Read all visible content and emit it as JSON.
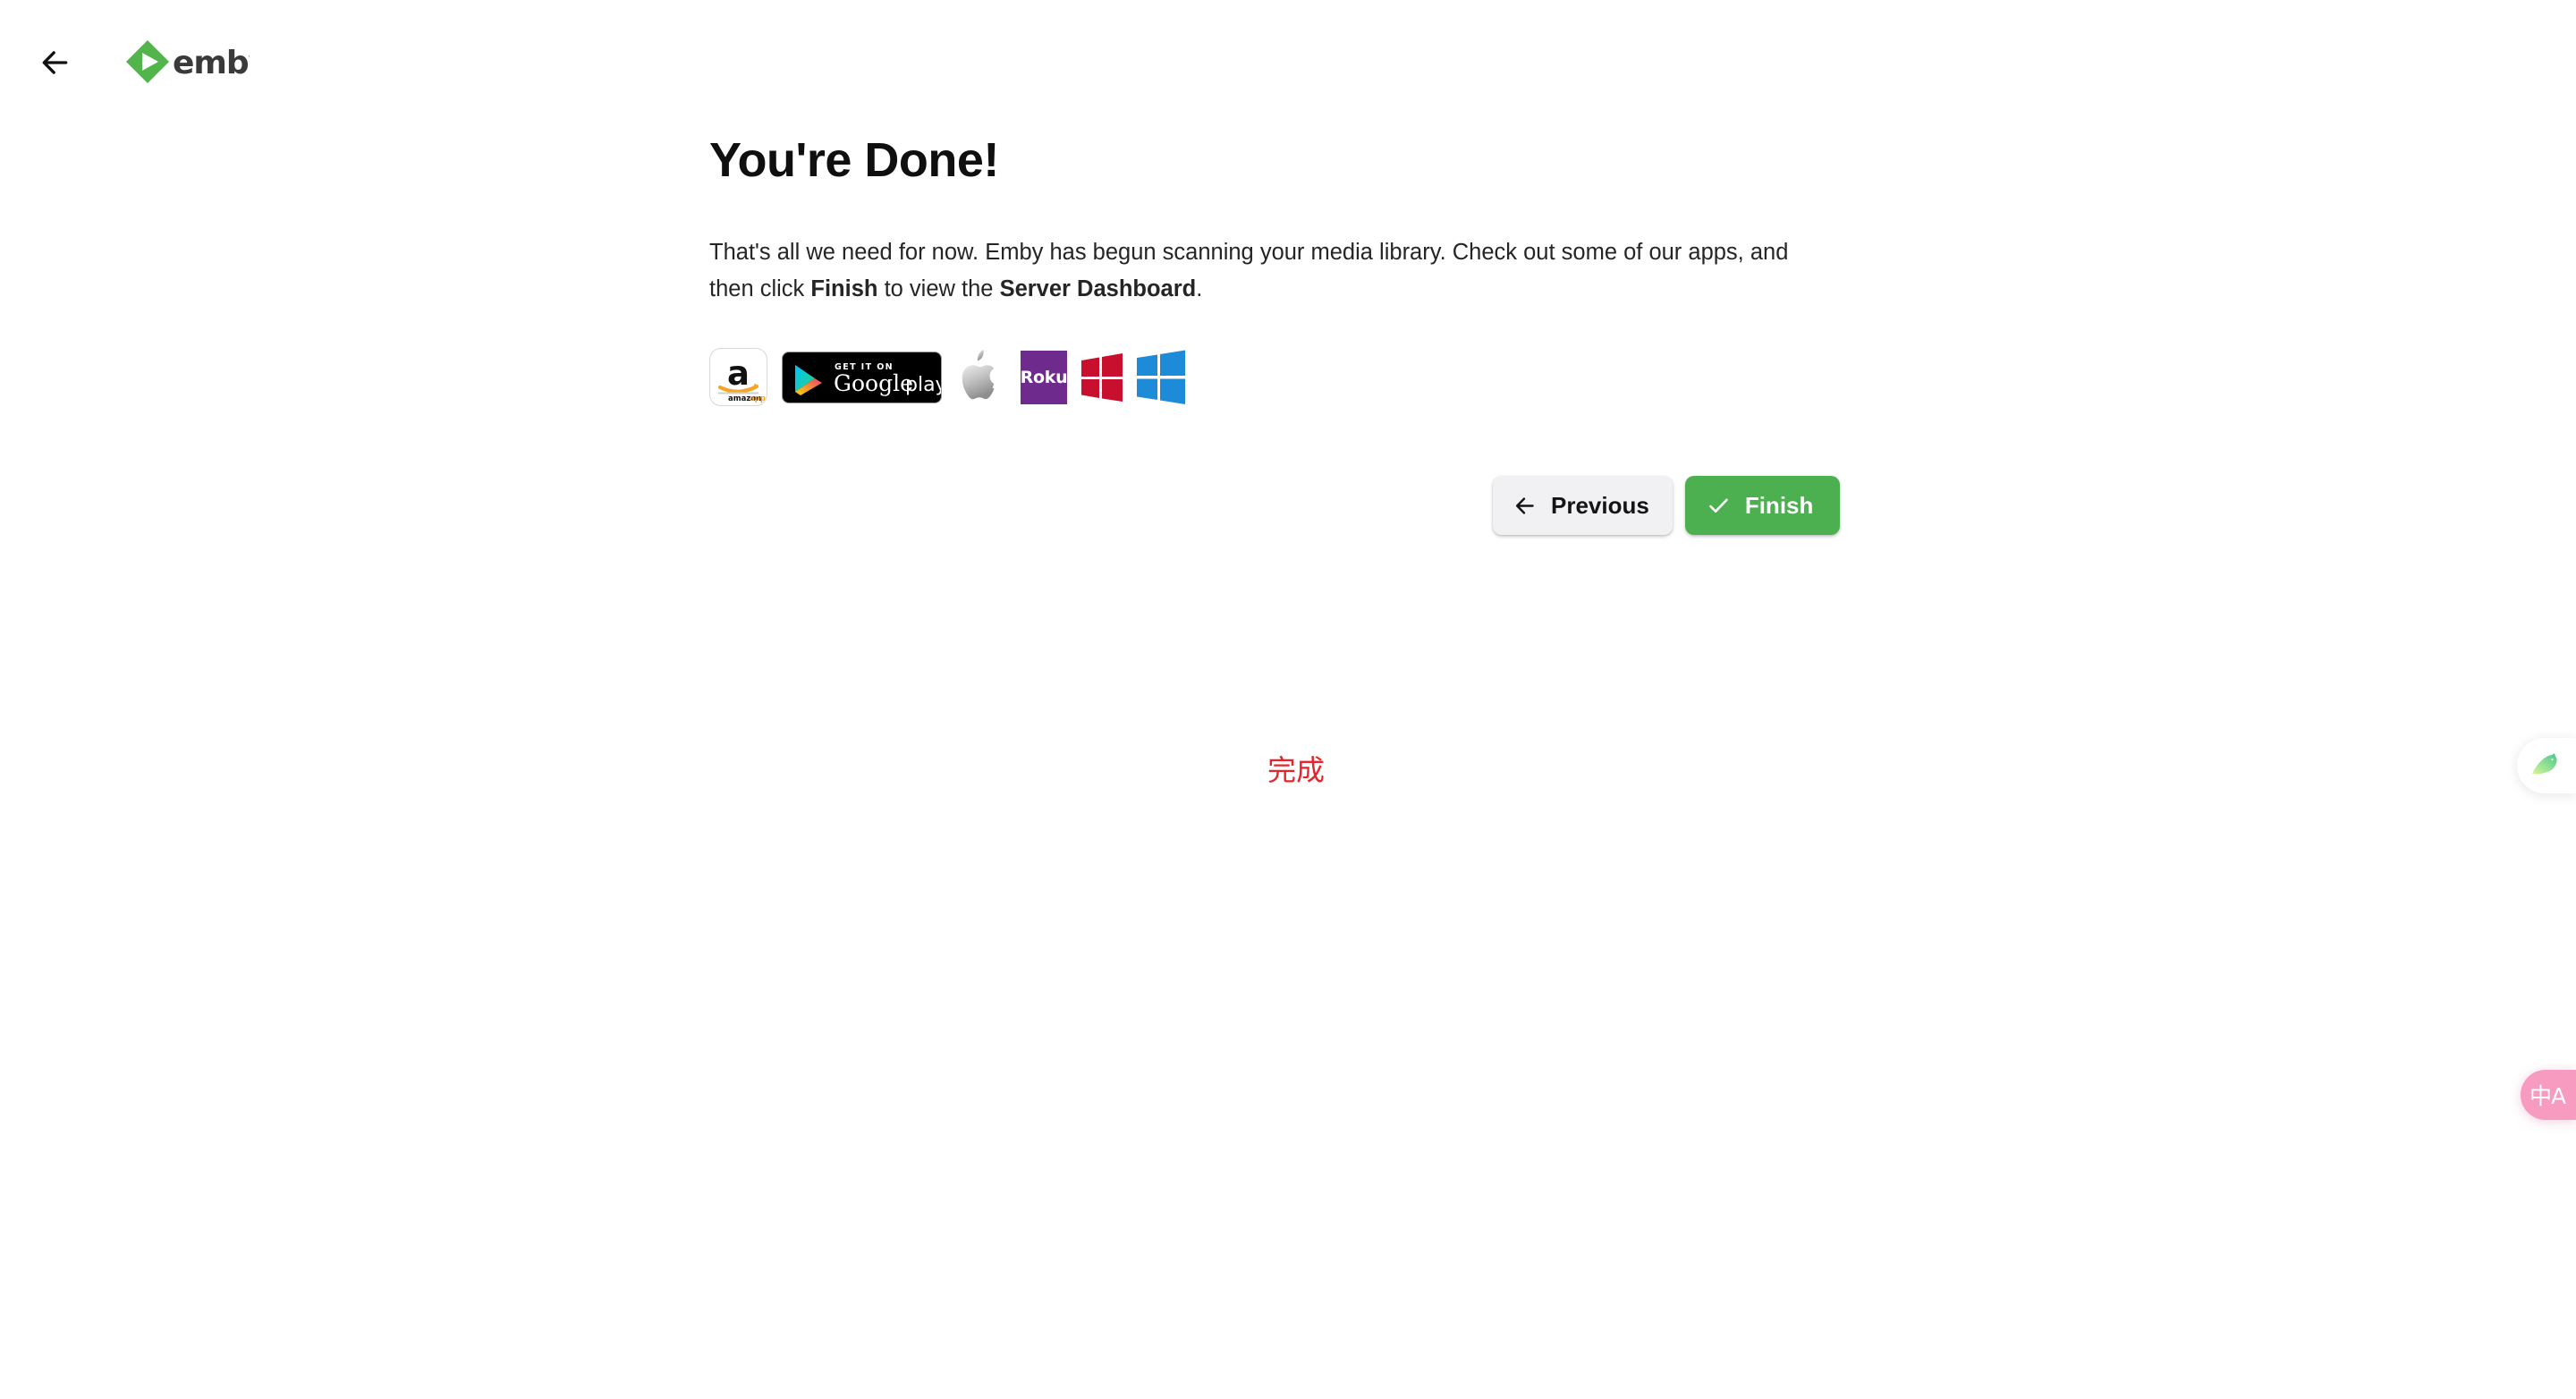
{
  "header": {
    "back_icon": "arrow-left-icon",
    "brand_name": "emby",
    "brand_logo_icon": "emby-diamond-play-icon",
    "brand_green": "#52B54B",
    "brand_text_color": "#3A3A3A"
  },
  "main": {
    "title": "You're Done!",
    "description_part1": "That's all we need for now. Emby has begun scanning your media library. Check out some of our apps, and then click ",
    "description_bold1": "Finish",
    "description_part2": " to view the ",
    "description_bold2": "Server Dashboard",
    "description_part3": "."
  },
  "app_badges": [
    {
      "name": "amazon-appstore-badge",
      "label": "amazonapps",
      "letter": "a"
    },
    {
      "name": "google-play-badge",
      "label_top": "GET IT ON",
      "label_main": "Google",
      "label_sub": "play"
    },
    {
      "name": "apple-app-store-badge",
      "label": "Apple"
    },
    {
      "name": "roku-badge",
      "label": "Roku",
      "color": "#6E2A8C"
    },
    {
      "name": "windows-phone-badge",
      "label": "Windows Phone",
      "color": "#C8102E"
    },
    {
      "name": "windows-badge",
      "label": "Windows",
      "color": "#1E8BD8"
    }
  ],
  "buttons": {
    "previous": {
      "label": "Previous",
      "icon": "arrow-left-icon",
      "bg": "#F1F1F3",
      "fg": "#141414"
    },
    "finish": {
      "label": "Finish",
      "icon": "check-icon",
      "bg": "#4CAF50",
      "fg": "#FFFFFF"
    }
  },
  "annotation": {
    "text": "完成",
    "color": "#E8242B"
  },
  "edge_widgets": {
    "bird": {
      "name": "bird-assistant-icon",
      "bg": "#FFFFFF"
    },
    "translate": {
      "name": "translate-icon",
      "glyph": "中A",
      "bg": "#F79BC0"
    }
  }
}
